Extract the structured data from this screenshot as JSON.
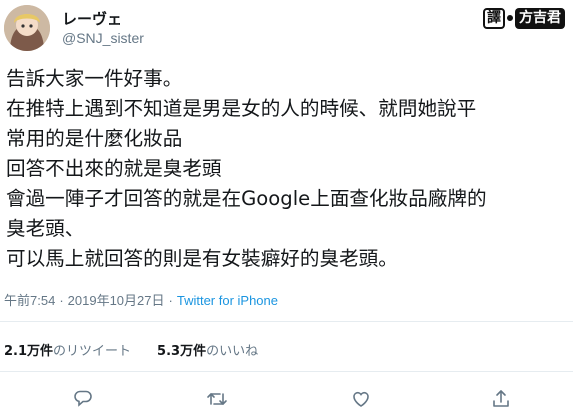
{
  "tweet": {
    "display_name": "レーヴェ",
    "handle": "@SNJ_sister",
    "body_lines": [
      "告訴大家一件好事。",
      "在推特上遇到不知道是男是女的人的時候、就問她說平",
      "常用的是什麼化妝品",
      "回答不出來的就是臭老頭",
      "會過一陣子才回答的就是在Google上面查化妝品廠牌的",
      "臭老頭、",
      "可以馬上就回答的則是有女裝癖好的臭老頭。"
    ],
    "time": "午前7:54",
    "separator": "·",
    "date": "2019年10月27日",
    "source": "Twitter for iPhone"
  },
  "watermark": {
    "left": "譯",
    "right": "方吉君"
  },
  "stats": {
    "retweets_count": "2.1万件",
    "retweets_label": "のリツイート",
    "likes_count": "5.3万件",
    "likes_label": "のいいね"
  },
  "icons": [
    "reply-icon",
    "retweet-icon",
    "like-icon",
    "share-icon"
  ],
  "colors": {
    "link": "#1b95e0",
    "muted": "#657786",
    "text": "#14171a",
    "divider": "#e6ecf0"
  }
}
